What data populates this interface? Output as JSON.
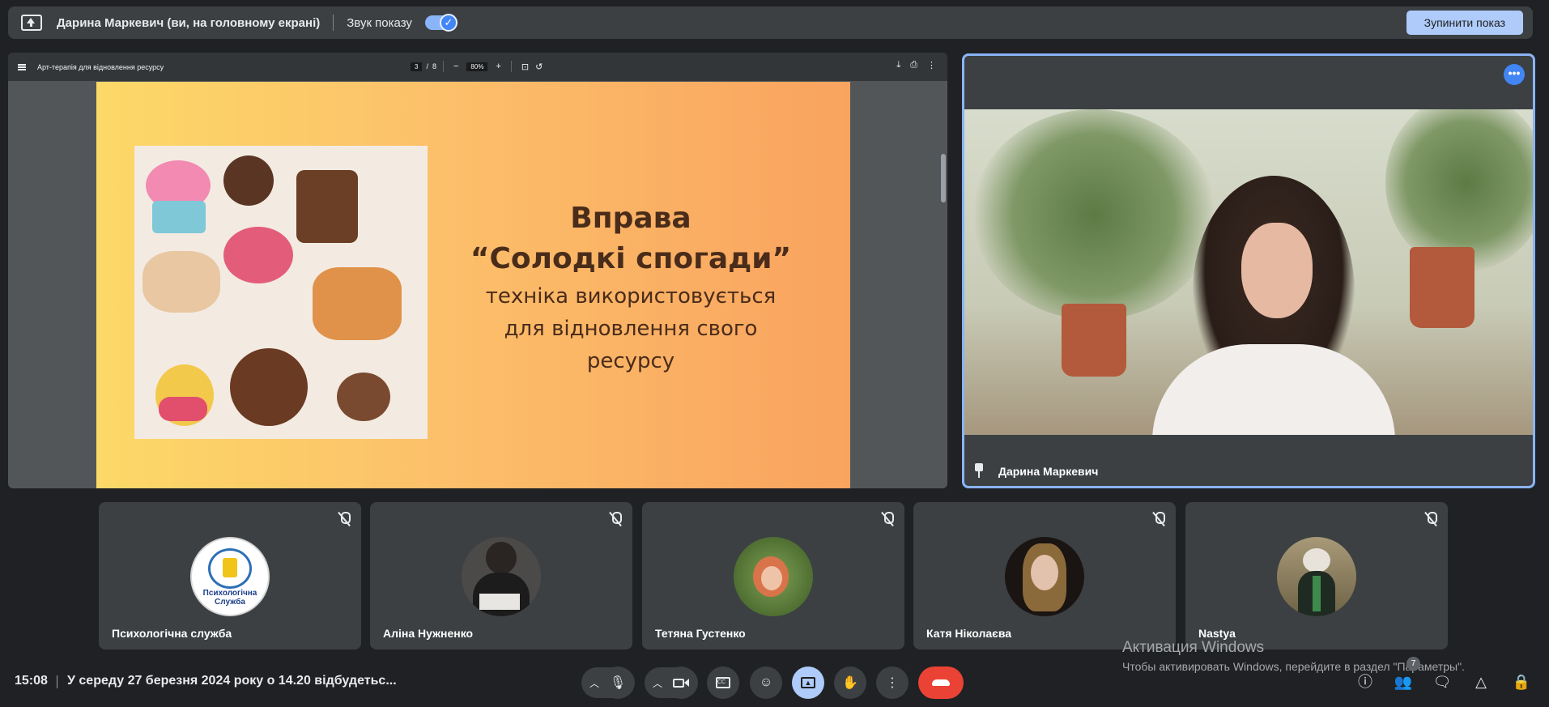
{
  "banner": {
    "presenter_text": "Дарина Маркевич (ви, на головному екрані)",
    "sound_label": "Звук показу",
    "stop_button": "Зупинити показ"
  },
  "pdf": {
    "title": "Арт-терапія для відновлення ресурсу",
    "page_current": "3",
    "page_separator": "/",
    "page_total": "8",
    "zoom": "80%"
  },
  "slide": {
    "line1": "Вправа",
    "line2": "“Солодкі спогади”",
    "line3": "техніка використовується",
    "line4": "для відновлення свого",
    "line5": "ресурсу"
  },
  "presenter_tile": {
    "name": "Дарина Маркевич",
    "more_label": "•••"
  },
  "participants": [
    {
      "name": "Психологічна служба",
      "avatar_text": "Психологічна Служба",
      "avatar_color": "#ffffff"
    },
    {
      "name": "Аліна Нужненко",
      "avatar_color": "#4b4a48"
    },
    {
      "name": "Тетяна Густенко",
      "avatar_color": "#5a7a3c"
    },
    {
      "name": "Катя Ніколаєва",
      "avatar_color": "#1a1412"
    },
    {
      "name": "Nastya",
      "avatar_color": "#8a7a5a"
    }
  ],
  "watermark": {
    "line1": "Активация Windows",
    "line2": "Чтобы активировать Windows, перейдите в раздел \"Параметры\"."
  },
  "bottom_bar": {
    "time": "15:08",
    "separator": "|",
    "meeting_title": "У середу 27 березня 2024 року о 14.20 відбудетьс...",
    "people_count": "7"
  },
  "colors": {
    "background": "#202124",
    "surface": "#3c4043",
    "accent": "#8ab4f8",
    "end_call": "#ea4335"
  }
}
